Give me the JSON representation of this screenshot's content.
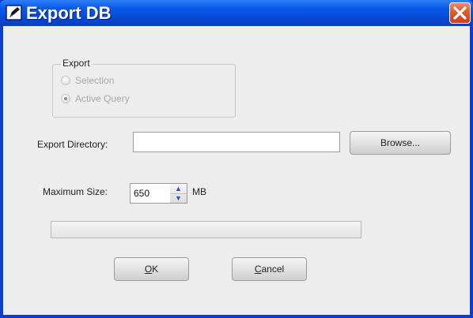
{
  "window": {
    "title": "Export DB"
  },
  "export_group": {
    "legend": "Export",
    "options": [
      {
        "label": "Selection",
        "checked": false
      },
      {
        "label": "Active Query",
        "checked": true
      }
    ]
  },
  "export_directory": {
    "label": "Export Directory:",
    "value": "",
    "browse_label": "Browse..."
  },
  "max_size": {
    "label": "Maximum Size:",
    "value": "650",
    "unit": "MB"
  },
  "progress": {
    "fraction": 0
  },
  "buttons": {
    "ok": {
      "mnemonic": "O",
      "rest": "K"
    },
    "cancel": {
      "mnemonic": "C",
      "rest": "ancel"
    }
  },
  "colors": {
    "titlebar": "#0b5ae8",
    "close": "#e05a2c",
    "dialog_bg": "#ededed"
  },
  "icons": {
    "title": "edit-document-icon",
    "close": "close-icon",
    "spin_up": "arrow-up-icon",
    "spin_down": "arrow-down-icon"
  }
}
